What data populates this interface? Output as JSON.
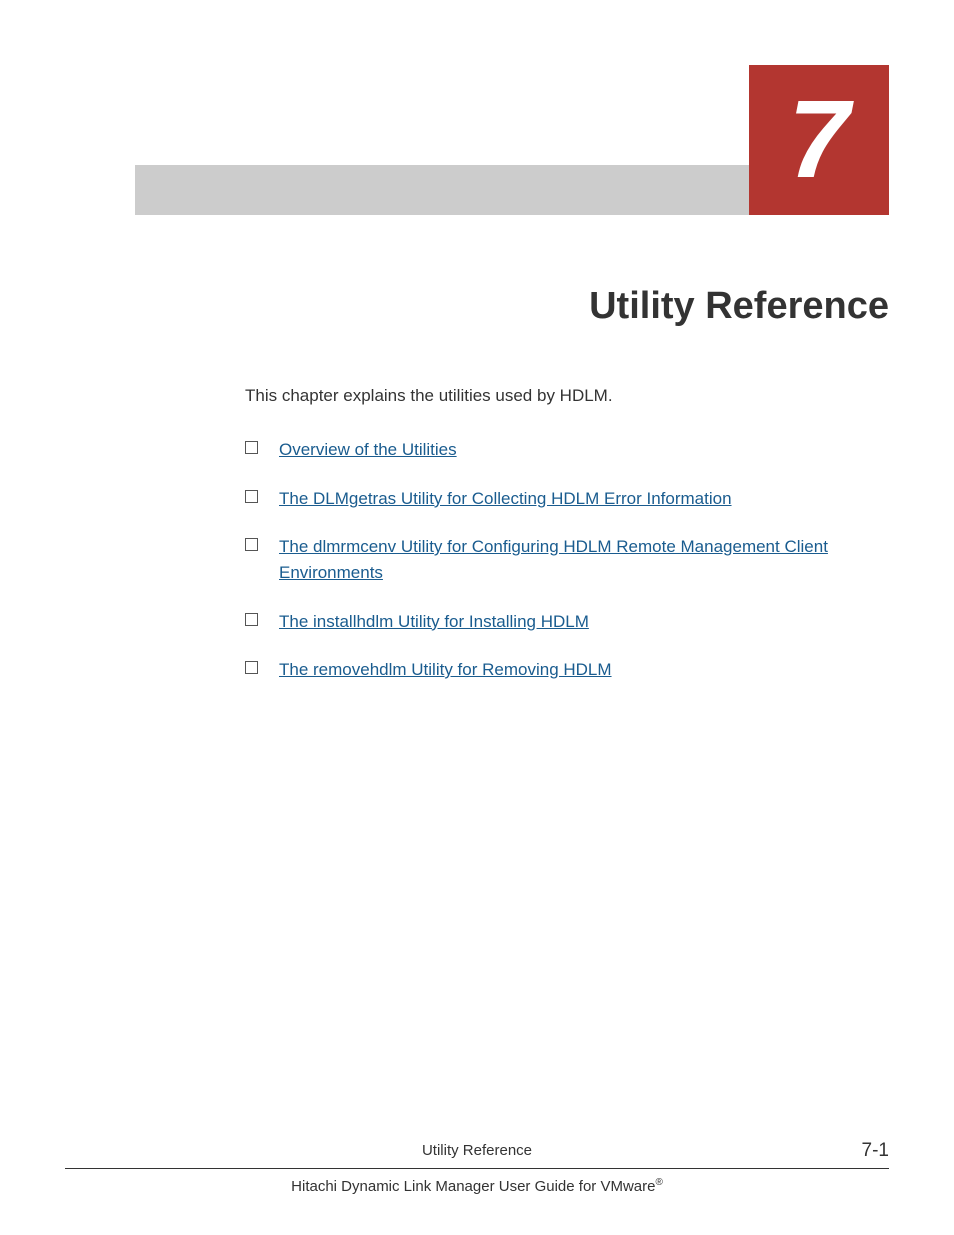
{
  "chapter": {
    "number": "7",
    "title": "Utility Reference",
    "intro": "This chapter explains the utilities used by HDLM."
  },
  "toc": [
    {
      "label": "Overview of the Utilities"
    },
    {
      "label": "The DLMgetras Utility for Collecting HDLM Error Information"
    },
    {
      "label": "The dlmrmcenv Utility for Configuring HDLM Remote Management Client Environments"
    },
    {
      "label": "The installhdlm Utility for Installing HDLM"
    },
    {
      "label": "The removehdlm Utility for Removing HDLM"
    }
  ],
  "footer": {
    "section": "Utility Reference",
    "page": "7-1",
    "guide_prefix": "Hitachi Dynamic Link Manager User Guide for VMware",
    "guide_suffix": "®"
  }
}
